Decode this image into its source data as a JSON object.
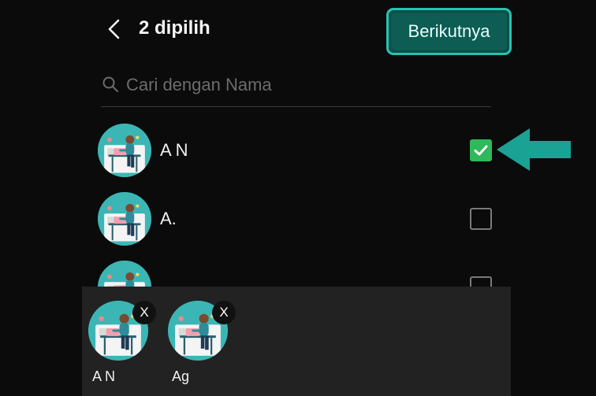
{
  "header": {
    "back_icon": "chevron-left-icon",
    "title": "2 dipilih",
    "next_label": "Berikutnya"
  },
  "search": {
    "icon": "search-icon",
    "placeholder": "Cari dengan Nama",
    "value": ""
  },
  "contacts": [
    {
      "name": "A N",
      "checked": true
    },
    {
      "name": "A.",
      "checked": false
    },
    {
      "name": "",
      "checked": false
    }
  ],
  "selected": [
    {
      "label": "A N",
      "remove_label": "X"
    },
    {
      "label": "Ag",
      "remove_label": "X"
    }
  ],
  "colors": {
    "background": "#0b0b0b",
    "accent": "#27c3b2",
    "button_fill": "#0d5d55",
    "check": "#2fb95a",
    "arrow": "#1aa394",
    "avatar": "#3cb6b4",
    "tray": "#222222"
  }
}
